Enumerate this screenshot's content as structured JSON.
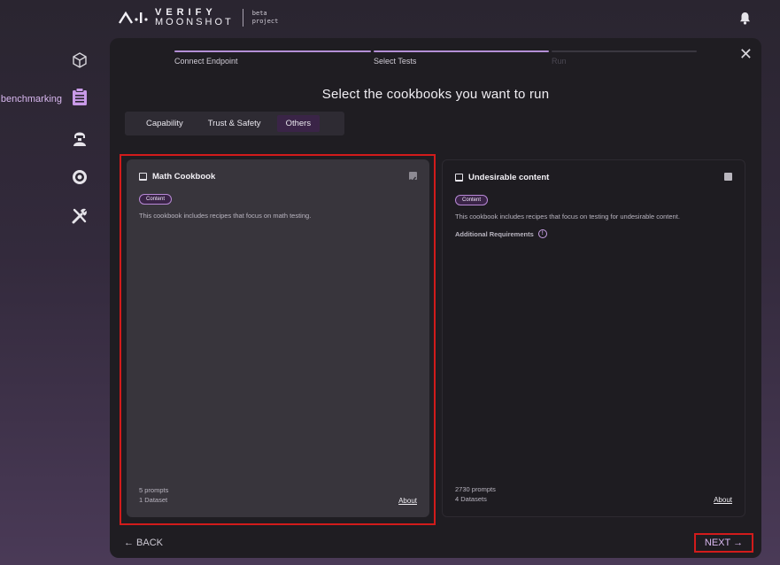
{
  "header": {
    "logo_verify": "VERIFY",
    "logo_moonshot": "MOONSHOT",
    "logo_beta": "beta",
    "logo_project": "project",
    "notification_icon": "bell-icon"
  },
  "sidebar": {
    "items": [
      {
        "name": "cube-icon",
        "label": ""
      },
      {
        "name": "clipboard-icon",
        "label": "benchmarking"
      },
      {
        "name": "agent-icon",
        "label": ""
      },
      {
        "name": "target-icon",
        "label": ""
      },
      {
        "name": "tools-icon",
        "label": ""
      }
    ],
    "accent": "#c99ae8"
  },
  "wizard": {
    "steps": [
      {
        "label": "Connect Endpoint",
        "state": "done"
      },
      {
        "label": "Select Tests",
        "state": "active"
      },
      {
        "label": "Run",
        "state": "pending"
      }
    ],
    "title": "Select the cookbooks you want to run",
    "tabs": [
      {
        "label": "Capability",
        "active": false
      },
      {
        "label": "Trust & Safety",
        "active": false
      },
      {
        "label": "Others",
        "active": true
      }
    ],
    "cards": [
      {
        "title": "Math Cookbook",
        "tag": "Content",
        "description": "This cookbook includes recipes that focus on math testing.",
        "additional_requirements": "",
        "prompts": "5 prompts",
        "datasets": "1 Dataset",
        "about": "About",
        "selected": true
      },
      {
        "title": "Undesirable content",
        "tag": "Content",
        "description": "This cookbook includes recipes that focus on testing for undesirable content.",
        "additional_requirements": "Additional Requirements",
        "prompts": "2730 prompts",
        "datasets": "4 Datasets",
        "about": "About",
        "selected": false
      }
    ],
    "back_label": "← BACK",
    "next_label": "NEXT →",
    "close_label": "✕"
  },
  "colors": {
    "highlight": "#d21b1b",
    "progress_done": "#b48fd6",
    "progress_pending": "#3a3740",
    "tab_active": "#3a2447"
  }
}
